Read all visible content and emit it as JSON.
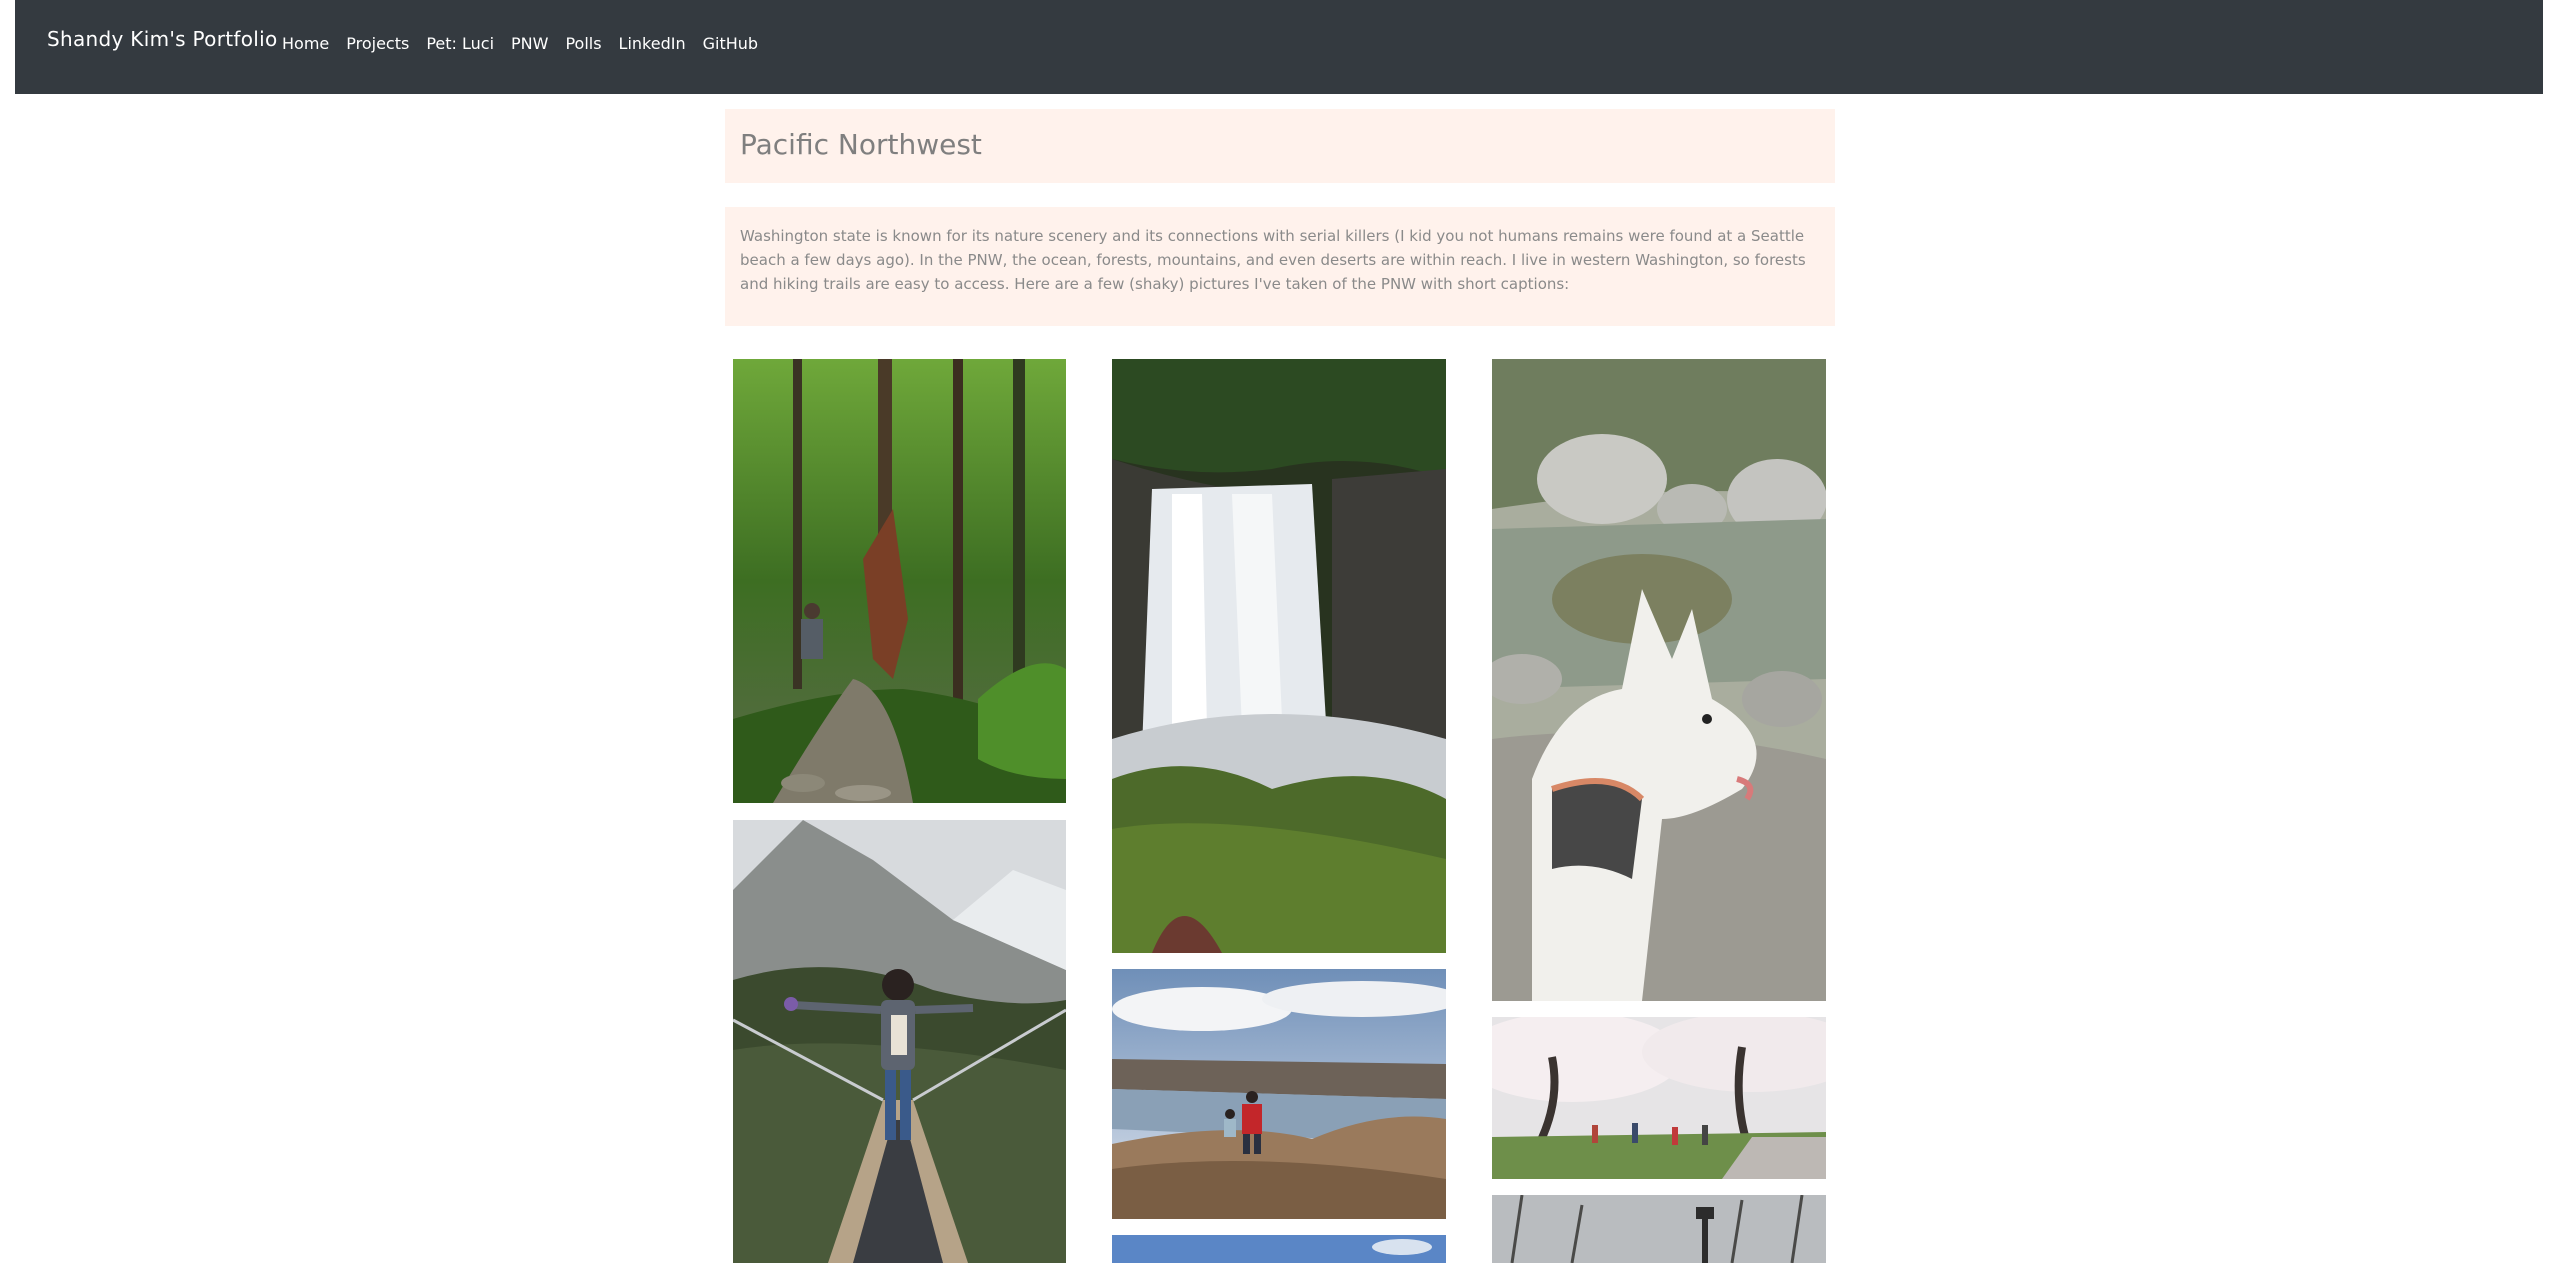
{
  "navbar": {
    "brand": "Shandy Kim's Portfolio",
    "links": [
      "Home",
      "Projects",
      "Pet: Luci",
      "PNW",
      "Polls",
      "LinkedIn",
      "GitHub"
    ]
  },
  "page": {
    "title": "Pacific Northwest",
    "intro": "Washington state is known for its nature scenery and its connections with serial killers (I kid you not humans remains were found at a Seattle beach a few days ago). In the PNW, the ocean, forests, mountains, and even deserts are within reach. I live in western Washington, so forests and hiking trails are easy to access. Here are a few (shaky) pictures I've taken of the PNW with short captions:"
  },
  "colors": {
    "navbar": "#343a40",
    "panel": "#fff2ec",
    "muted_text": "#8a8a8a"
  },
  "gallery": {
    "photos": [
      {
        "subject": "forest-trail-hiker"
      },
      {
        "subject": "suspension-bridge-person"
      },
      {
        "subject": "waterfall"
      },
      {
        "subject": "river-cliff-overlook"
      },
      {
        "subject": "blue-sky-landscape"
      },
      {
        "subject": "white-husky-dog"
      },
      {
        "subject": "cherry-blossom-quad"
      },
      {
        "subject": "winter-park-lamp"
      }
    ]
  }
}
